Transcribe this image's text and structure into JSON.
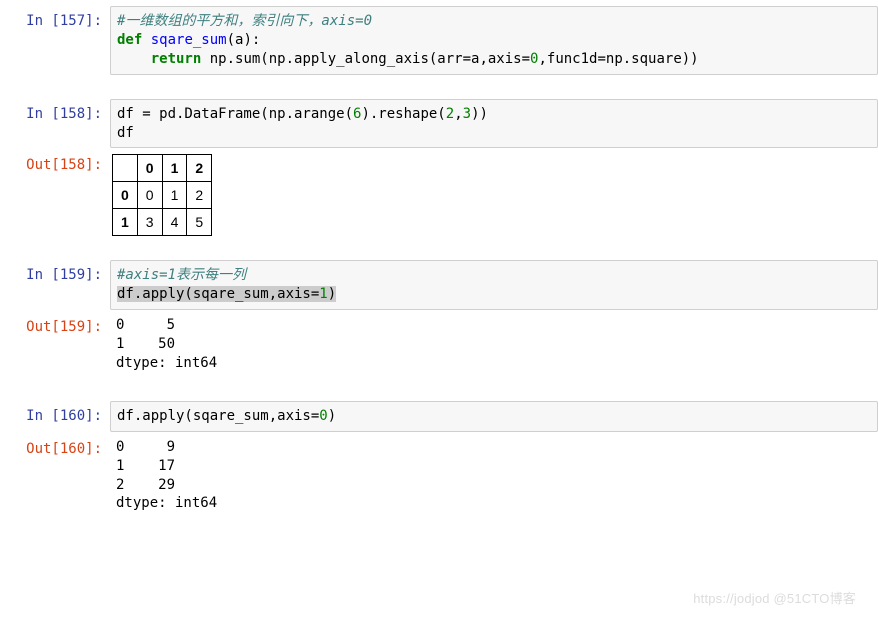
{
  "cells": {
    "c157": {
      "prompt": "In [157]:",
      "code": {
        "comment": "#一维数组的平方和，索引向下，axis=0",
        "l2a": "def",
        "l2b": " ",
        "l2c": "sqare_sum",
        "l2d": "(a):",
        "l3a": "    ",
        "l3b": "return",
        "l3c": " np.sum(np.apply_along_axis(arr=a,axis=",
        "l3d": "0",
        "l3e": ",func1d=np.square))"
      }
    },
    "c158": {
      "prompt": "In [158]:",
      "code": {
        "a": "df = pd.DataFrame(np.arange(",
        "b": "6",
        "c": ").reshape(",
        "d": "2",
        "e": ",",
        "f": "3",
        "g": "))\ndf"
      },
      "out_prompt": "Out[158]:",
      "table": {
        "cols": [
          "0",
          "1",
          "2"
        ],
        "idx": [
          "0",
          "1"
        ],
        "data": [
          [
            "0",
            "1",
            "2"
          ],
          [
            "3",
            "4",
            "5"
          ]
        ]
      }
    },
    "c159": {
      "prompt": "In [159]:",
      "code": {
        "comment": "#axis=1表示每一列",
        "l2a": "df.apply(sqare_sum,axis=",
        "l2b": "1",
        "l2c": ")"
      },
      "out_prompt": "Out[159]:",
      "output": "0     5\n1    50\ndtype: int64"
    },
    "c160": {
      "prompt": "In [160]:",
      "code": {
        "a": "df.apply(sqare_sum,axis=",
        "b": "0",
        "c": ")"
      },
      "out_prompt": "Out[160]:",
      "output": "0     9\n1    17\n2    29\ndtype: int64"
    }
  },
  "watermark": "https://jodjod @51CTO博客"
}
